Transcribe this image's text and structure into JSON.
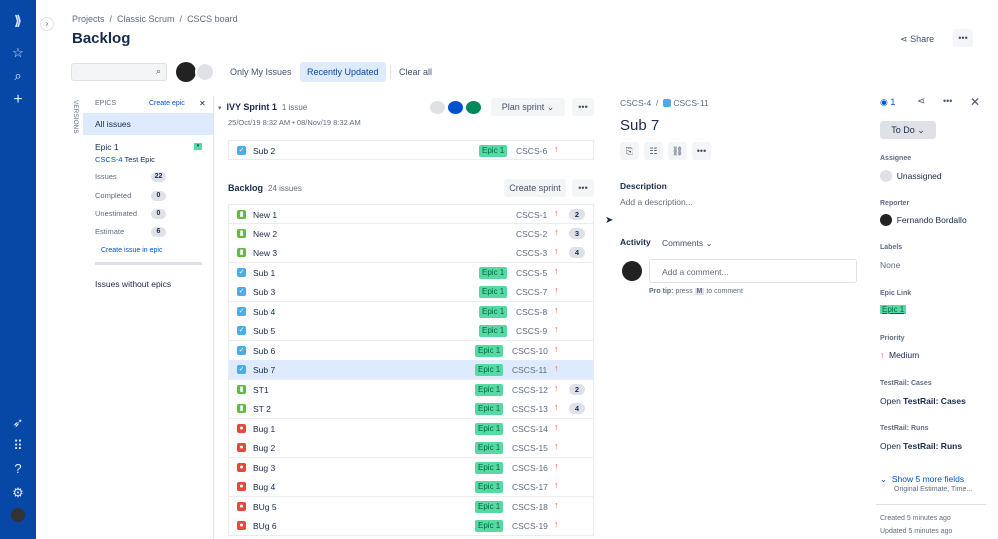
{
  "nav": {
    "icons": [
      "jira-logo-icon",
      "star-icon",
      "search-icon",
      "plus-icon",
      "rocket-icon",
      "apps-grid-icon",
      "help-icon",
      "settings-icon",
      "user-avatar"
    ]
  },
  "breadcrumbs": [
    "Projects",
    "Classic Scrum",
    "CSCS board"
  ],
  "title": "Backlog",
  "share_label": "Share",
  "filters": {
    "only_my": "Only My Issues",
    "recent": "Recently Updated",
    "clear": "Clear all"
  },
  "epics": {
    "versions_label": "VERSIONS",
    "header": "EPICS",
    "create": "Create epic",
    "all": "All issues",
    "epic_name": "Epic 1",
    "epic_key": "CSCS-4",
    "epic_summary": "Test Epic",
    "stats": [
      {
        "label": "Issues",
        "value": "22"
      },
      {
        "label": "Completed",
        "value": "0"
      },
      {
        "label": "Unestimated",
        "value": "0"
      },
      {
        "label": "Estimate",
        "value": "6"
      }
    ],
    "create_issue": "Create issue in epic",
    "without": "Issues without epics"
  },
  "sprint": {
    "name": "IVY Sprint 1",
    "count": "1 issue",
    "dates": "25/Oct/19 8:32 AM • 08/Nov/19 8:32 AM",
    "plan": "Plan sprint",
    "issues": [
      {
        "type": "subtask",
        "name": "Sub 2",
        "epic": "Epic 1",
        "key": "CSCS-6",
        "est": ""
      }
    ]
  },
  "backlog": {
    "name": "Backlog",
    "count": "24 issues",
    "create": "Create sprint",
    "issues": [
      {
        "type": "story",
        "name": "New 1",
        "epic": "",
        "key": "CSCS-1",
        "est": "2"
      },
      {
        "type": "story",
        "name": "New 2",
        "epic": "",
        "key": "CSCS-2",
        "est": "3"
      },
      {
        "type": "story",
        "name": "New 3",
        "epic": "",
        "key": "CSCS-3",
        "est": "4"
      },
      {
        "type": "subtask",
        "name": "Sub 1",
        "epic": "Epic 1",
        "key": "CSCS-5",
        "est": ""
      },
      {
        "type": "subtask",
        "name": "Sub 3",
        "epic": "Epic 1",
        "key": "CSCS-7",
        "est": ""
      },
      {
        "type": "subtask",
        "name": "Sub 4",
        "epic": "Epic 1",
        "key": "CSCS-8",
        "est": ""
      },
      {
        "type": "subtask",
        "name": "Sub 5",
        "epic": "Epic 1",
        "key": "CSCS-9",
        "est": ""
      },
      {
        "type": "subtask",
        "name": "Sub 6",
        "epic": "Epic 1",
        "key": "CSCS-10",
        "est": ""
      },
      {
        "type": "subtask",
        "name": "Sub 7",
        "epic": "Epic 1",
        "key": "CSCS-11",
        "est": "",
        "selected": true
      },
      {
        "type": "story",
        "name": "ST1",
        "epic": "Epic 1",
        "key": "CSCS-12",
        "est": "2"
      },
      {
        "type": "story",
        "name": "ST 2",
        "epic": "Epic 1",
        "key": "CSCS-13",
        "est": "4"
      },
      {
        "type": "bug",
        "name": "Bug 1",
        "epic": "Epic 1",
        "key": "CSCS-14",
        "est": ""
      },
      {
        "type": "bug",
        "name": "Bug 2",
        "epic": "Epic 1",
        "key": "CSCS-15",
        "est": ""
      },
      {
        "type": "bug",
        "name": "Bug 3",
        "epic": "Epic 1",
        "key": "CSCS-16",
        "est": ""
      },
      {
        "type": "bug",
        "name": "Bug 4",
        "epic": "Epic 1",
        "key": "CSCS-17",
        "est": ""
      },
      {
        "type": "bug",
        "name": "BUg 5",
        "epic": "Epic 1",
        "key": "CSCS-18",
        "est": ""
      },
      {
        "type": "bug",
        "name": "BUg 6",
        "epic": "Epic 1",
        "key": "CSCS-19",
        "est": ""
      }
    ]
  },
  "detail": {
    "parent": "CSCS-4",
    "key": "CSCS-11",
    "title": "Sub 7",
    "desc_label": "Description",
    "desc_placeholder": "Add a description...",
    "activity": "Activity",
    "comments": "Comments",
    "comment_placeholder": "Add a comment...",
    "tip_prefix": "Pro tip:",
    "tip_mid": "press",
    "tip_key": "M",
    "tip_suffix": "to comment",
    "watchers": "1",
    "status": "To Do",
    "fields": {
      "assignee_label": "Assignee",
      "assignee": "Unassigned",
      "reporter_label": "Reporter",
      "reporter": "Fernando Bordallo",
      "labels_label": "Labels",
      "labels": "None",
      "epic_label": "Epic Link",
      "epic": "Epic 1",
      "priority_label": "Priority",
      "priority": "Medium",
      "tr_cases_label": "TestRail: Cases",
      "tr_open": "Open",
      "tr_cases": "TestRail: Cases",
      "tr_runs_label": "TestRail: Runs",
      "tr_runs": "TestRail: Runs",
      "more": "Show 5 more fields",
      "more_sub": "Original Estimate, Time...",
      "created": "Created 5 minutes ago",
      "updated": "Updated 5 minutes ago"
    }
  },
  "colors": {
    "nav": "#0747A6",
    "epic": "#57D9A3",
    "subtask": "#4BADE8",
    "story": "#65BA43",
    "bug": "#E5493A",
    "accent": "#0052CC"
  }
}
